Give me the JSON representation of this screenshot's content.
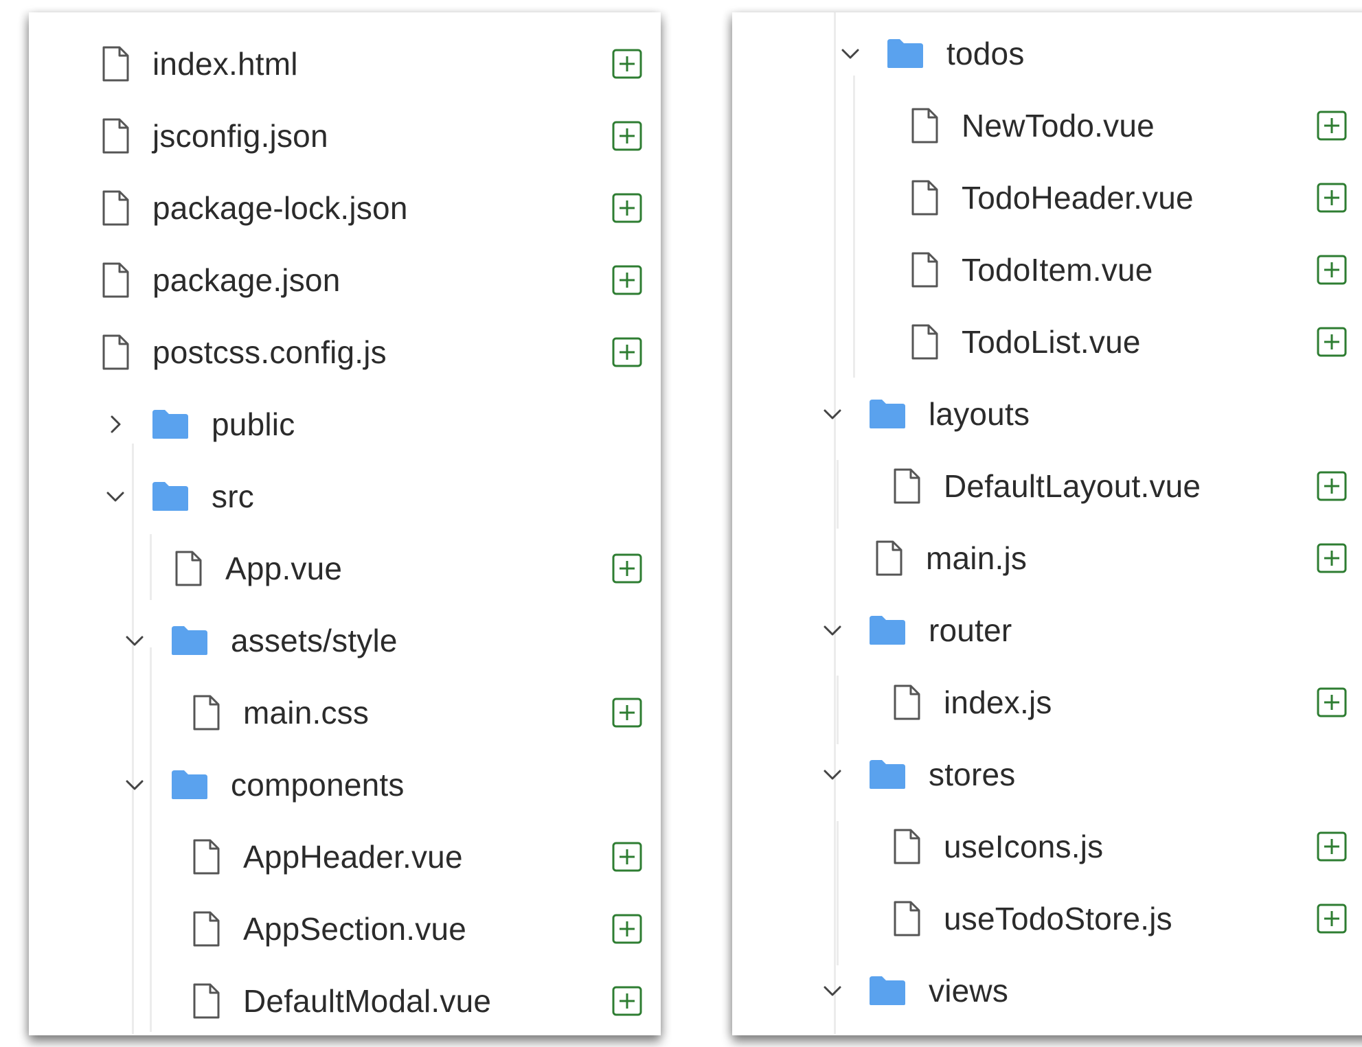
{
  "left_panel": {
    "items": [
      {
        "label": "index.html",
        "kind": "file"
      },
      {
        "label": "jsconfig.json",
        "kind": "file"
      },
      {
        "label": "package-lock.json",
        "kind": "file"
      },
      {
        "label": "package.json",
        "kind": "file"
      },
      {
        "label": "postcss.config.js",
        "kind": "file"
      },
      {
        "label": "public",
        "kind": "folder",
        "state": "collapsed"
      },
      {
        "label": "src",
        "kind": "folder",
        "state": "expanded"
      },
      {
        "label": "App.vue",
        "kind": "file"
      },
      {
        "label": "assets/style",
        "kind": "folder",
        "state": "expanded"
      },
      {
        "label": "main.css",
        "kind": "file"
      },
      {
        "label": "components",
        "kind": "folder",
        "state": "expanded"
      },
      {
        "label": "AppHeader.vue",
        "kind": "file"
      },
      {
        "label": "AppSection.vue",
        "kind": "file"
      },
      {
        "label": "DefaultModal.vue",
        "kind": "file"
      }
    ]
  },
  "right_panel": {
    "items": [
      {
        "label": "todos",
        "kind": "folder",
        "state": "expanded"
      },
      {
        "label": "NewTodo.vue",
        "kind": "file"
      },
      {
        "label": "TodoHeader.vue",
        "kind": "file"
      },
      {
        "label": "TodoItem.vue",
        "kind": "file"
      },
      {
        "label": "TodoList.vue",
        "kind": "file"
      },
      {
        "label": "layouts",
        "kind": "folder",
        "state": "expanded"
      },
      {
        "label": "DefaultLayout.vue",
        "kind": "file"
      },
      {
        "label": "main.js",
        "kind": "file"
      },
      {
        "label": "router",
        "kind": "folder",
        "state": "expanded"
      },
      {
        "label": "index.js",
        "kind": "file"
      },
      {
        "label": "stores",
        "kind": "folder",
        "state": "expanded"
      },
      {
        "label": "useIcons.js",
        "kind": "file"
      },
      {
        "label": "useTodoStore.js",
        "kind": "file"
      },
      {
        "label": "views",
        "kind": "folder",
        "state": "expanded"
      }
    ]
  },
  "icons": {
    "file": "file-icon",
    "folder": "folder-icon",
    "add": "add-file-icon",
    "expanded": "chevron-down-icon",
    "collapsed": "chevron-right-icon"
  },
  "colors": {
    "folder": "#5aa2ee",
    "add": "#2e7d32",
    "text": "#2b2b2b",
    "file_outline": "#555555"
  }
}
